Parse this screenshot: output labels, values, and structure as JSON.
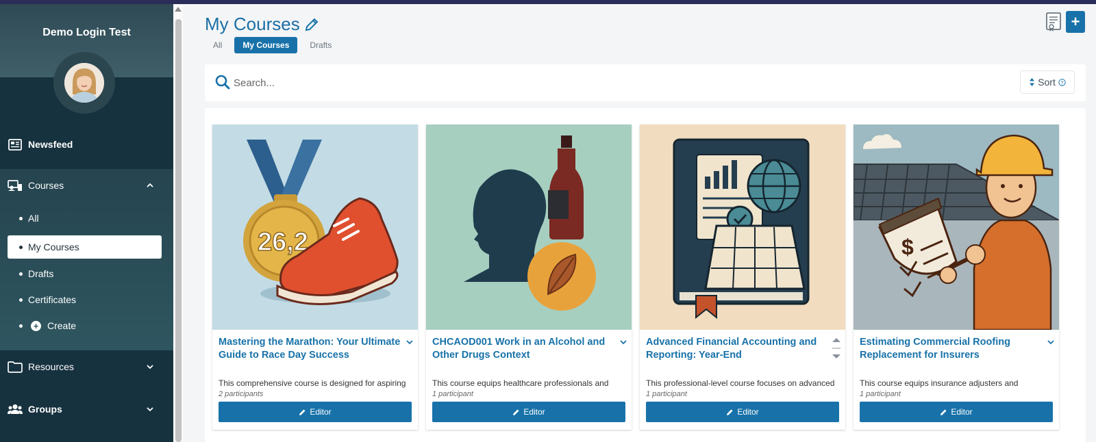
{
  "sidebar": {
    "user_name": "Demo Login Test",
    "nav": {
      "newsfeed": "Newsfeed",
      "courses": "Courses",
      "resources": "Resources",
      "groups": "Groups"
    },
    "courses_sub": {
      "all": "All",
      "my_courses": "My Courses",
      "drafts": "Drafts",
      "certificates": "Certificates",
      "create": "Create"
    },
    "active_item": "My Courses"
  },
  "header": {
    "title": "My Courses",
    "tabs": [
      "All",
      "My Courses",
      "Drafts"
    ],
    "active_tab": "My Courses",
    "add_label": "+"
  },
  "search": {
    "placeholder": "Search...",
    "sort_label": "Sort"
  },
  "courses": [
    {
      "title": "Mastering the Marathon: Your Ultimate Guide to Race Day Success",
      "description": "This comprehensive course is designed for aspiring",
      "participants": "2 participants",
      "editor_label": "Editor",
      "image_icon": "marathon-medal-shoe"
    },
    {
      "title": "CHCAOD001 Work in an Alcohol and Other Drugs Context",
      "description": "This course equips healthcare professionals and",
      "participants": "1 participant",
      "editor_label": "Editor",
      "image_icon": "head-bottle-leaf"
    },
    {
      "title": "Advanced Financial Accounting and Reporting: Year-End",
      "description": "This professional-level course focuses on advanced",
      "participants": "1 participant",
      "editor_label": "Editor",
      "image_icon": "ledger-book-chart"
    },
    {
      "title": "Estimating Commercial Roofing Replacement for Insurers",
      "description": "This course equips insurance adjusters and",
      "participants": "1 participant",
      "editor_label": "Editor",
      "image_icon": "roofer-clipboard"
    }
  ],
  "colors": {
    "accent": "#1872a9",
    "sidebar_bg": "#17323f",
    "top_bar": "#2b2d59"
  }
}
